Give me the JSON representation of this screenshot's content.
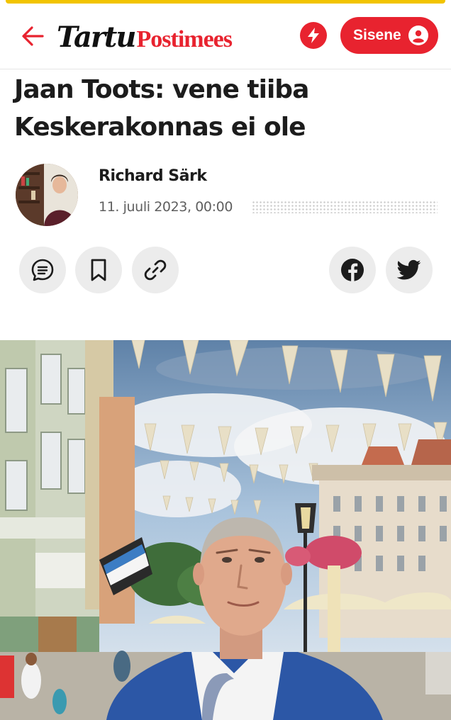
{
  "header": {
    "back_icon": "arrow-left-icon",
    "logo": {
      "part1": "Tartu",
      "part2": "Postimees"
    },
    "flash_icon": "lightning-icon",
    "login": {
      "label": "Sisene",
      "icon": "user-icon"
    }
  },
  "article": {
    "headline": "Jaan Toots: vene tiiba Keskerakonnas ei ole",
    "author": {
      "name": "Richard Särk"
    },
    "date": "11. juuli 2023, 00:00"
  },
  "actions": {
    "left": [
      "comments-icon",
      "bookmark-icon",
      "link-icon"
    ],
    "right": [
      "facebook-icon",
      "twitter-icon"
    ]
  },
  "colors": {
    "brand_red": "#e8232f",
    "accent_yellow": "#f2c400",
    "button_grey": "#ececec"
  }
}
